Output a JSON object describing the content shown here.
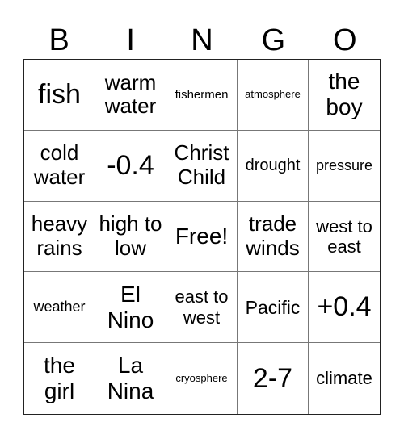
{
  "header": [
    "B",
    "I",
    "N",
    "G",
    "O"
  ],
  "cells": [
    "fish",
    "warm water",
    "fishermen",
    "atmosphere",
    "the boy",
    "cold water",
    "-0.4",
    "Christ Child",
    "drought",
    "pressure",
    "heavy rains",
    "high to low",
    "Free!",
    "trade winds",
    "west to east",
    "weather",
    "El Nino",
    "east to west",
    "Pacific",
    "+0.4",
    "the girl",
    "La Nina",
    "cryosphere",
    "2-7",
    "climate"
  ]
}
